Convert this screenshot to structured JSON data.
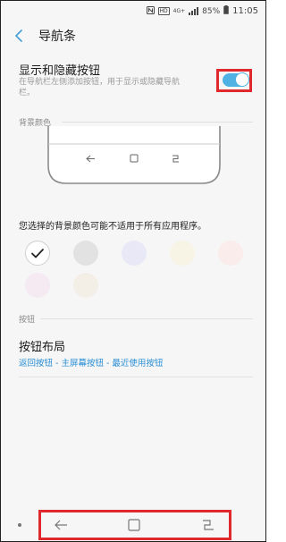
{
  "status_bar": {
    "nfc_icon": "nfc-icon",
    "network_label": "4G+",
    "battery_percent": "85%",
    "time": "11:05"
  },
  "header": {
    "title": "导航条",
    "back_icon": "chevron-left-icon"
  },
  "show_hide_buttons": {
    "title": "显示和隐藏按钮",
    "description": "在导航栏左侧添加按钮，用于显示或隐藏导航栏。",
    "enabled": true
  },
  "background_color": {
    "section_label": "背景颜色",
    "note": "您选择的背景颜色可能不适用于所有应用程序。",
    "selected_index": 0,
    "colors": [
      "#ffffff",
      "#e2e2e2",
      "#e8e8f7",
      "#f7f4e6",
      "#f9eceb",
      "#f5e9f2",
      "#f3efe6"
    ]
  },
  "buttons_section": {
    "section_label": "按钮",
    "layout_title": "按钮布局",
    "layout_value": "返回按钮 - 主屏幕按钮 - 最近使用按钮"
  },
  "navbar": {
    "hide_dot_icon": "dot-icon",
    "back_icon": "back-arrow-icon",
    "home_icon": "home-square-icon",
    "recents_icon": "recents-icon"
  },
  "colors": {
    "accent": "#4fb2e3",
    "link": "#2b8fd6",
    "highlight": "#e0292d"
  }
}
